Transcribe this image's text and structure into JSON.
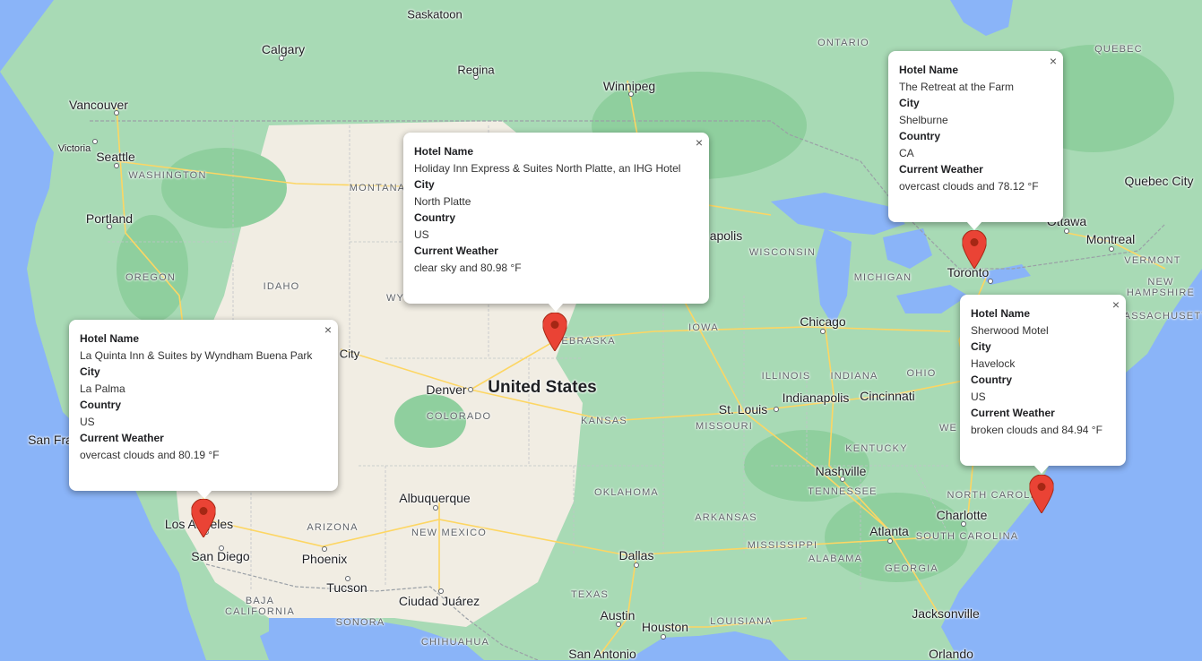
{
  "map": {
    "country_label": "United States",
    "region_labels": [
      "ONTARIO",
      "QUEBEC"
    ],
    "state_labels": [
      "WASHINGTON",
      "OREGON",
      "IDAHO",
      "MONTANA",
      "WY",
      "NEBRASKA",
      "IOWA",
      "WISCONSIN",
      "MICHIGAN",
      "ILLINOIS",
      "INDIANA",
      "OHIO",
      "KANSAS",
      "MISSOURI",
      "KENTUCKY",
      "TENNESSEE",
      "OKLAHOMA",
      "ARKANSAS",
      "MISSISSIPPI",
      "ALABAMA",
      "GEORGIA",
      "TEXAS",
      "LOUISIANA",
      "COLORADO",
      "NEW MEXICO",
      "ARIZONA",
      "NORTH CAROLINA",
      "SOUTH CAROLINA",
      "VERMONT",
      "NEW HAMPSHIRE",
      "MASSACHUSETTS",
      "BAJA CALIFORNIA",
      "SONORA",
      "CHIHUAHUA",
      "WE"
    ],
    "city_labels": [
      "Saskatoon",
      "Calgary",
      "Regina",
      "Winnipeg",
      "Vancouver",
      "Victoria",
      "Seattle",
      "Portland",
      "San Fra",
      "Los Angeles",
      "San Diego",
      "Phoenix",
      "Tucson",
      "Albuquerque",
      "Denver",
      "Ciudad Juárez",
      "Chicago",
      "Indianapolis",
      "Cincinnati",
      "St. Louis",
      "Nashville",
      "Atlanta",
      "Charlotte",
      "Jacksonville",
      "Dallas",
      "Austin",
      "Houston",
      "San Antonio",
      "Orlando",
      "Toronto",
      "Ottawa",
      "Montreal",
      "Quebec City",
      "apolis",
      "City"
    ]
  },
  "info_windows": [
    {
      "hotel_name_label": "Hotel Name",
      "hotel_name": "La Quinta Inn & Suites by Wyndham Buena Park",
      "city_label": "City",
      "city": "La Palma",
      "country_label": "Country",
      "country": "US",
      "weather_label": "Current Weather",
      "weather": "overcast clouds and 80.19 °F",
      "close": "×"
    },
    {
      "hotel_name_label": "Hotel Name",
      "hotel_name": "Holiday Inn Express & Suites North Platte, an IHG Hotel",
      "city_label": "City",
      "city": "North Platte",
      "country_label": "Country",
      "country": "US",
      "weather_label": "Current Weather",
      "weather": "clear sky and 80.98 °F",
      "close": "×"
    },
    {
      "hotel_name_label": "Hotel Name",
      "hotel_name": "The Retreat at the Farm",
      "city_label": "City",
      "city": "Shelburne",
      "country_label": "Country",
      "country": "CA",
      "weather_label": "Current Weather",
      "weather": "overcast clouds and 78.12 °F",
      "close": "×"
    },
    {
      "hotel_name_label": "Hotel Name",
      "hotel_name": "Sherwood Motel",
      "city_label": "City",
      "city": "Havelock",
      "country_label": "Country",
      "country": "US",
      "weather_label": "Current Weather",
      "weather": "broken clouds and 84.94 °F",
      "close": "×"
    }
  ],
  "colors": {
    "water": "#8ab4f8",
    "land_green": "#a8dab5",
    "land_arid": "#f1ede3",
    "road": "#fdd663",
    "marker": "#ea4335",
    "marker_dark": "#a52714",
    "border": "#9aa0a6"
  },
  "icons": {
    "marker": "map-pin-icon",
    "close": "close-icon"
  }
}
